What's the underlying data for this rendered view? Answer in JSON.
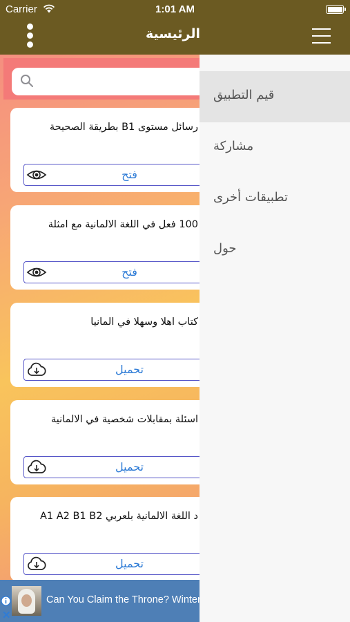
{
  "status_bar": {
    "carrier": "Carrier",
    "time": "1:01 AM"
  },
  "nav": {
    "title": "الرئيسية"
  },
  "search": {
    "placeholder": ""
  },
  "cards": [
    {
      "title": "رسائل مستوى B1 بطريقة الصحيحة",
      "action": "فتح",
      "icon": "eye-icon"
    },
    {
      "title": "100 فعل في اللغة الالمانية مع امثلة",
      "action": "فتح",
      "icon": "eye-icon"
    },
    {
      "title": "كتاب اهلا وسهلا في المانيا",
      "action": "تحميل",
      "icon": "cloud-download-icon"
    },
    {
      "title": "اسئلة بمقابلات شخصية في الالمانية",
      "action": "تحميل",
      "icon": "cloud-download-icon"
    },
    {
      "title": "د اللغة الالمانية بلعربي A1 A2 B1 B2",
      "action": "تحميل",
      "icon": "cloud-download-icon"
    }
  ],
  "ad": {
    "text": "Can You Claim the Throne? Winter is Coming"
  },
  "drawer": {
    "items": [
      {
        "label": "قيم التطبيق"
      },
      {
        "label": "مشاركة"
      },
      {
        "label": "تطبيقات أخرى"
      },
      {
        "label": "حول"
      }
    ]
  },
  "colors": {
    "nav_bar": "#6b5a22",
    "action_border": "#5656c8",
    "action_text": "#2d7bd6",
    "drawer_bg": "#f7f7f7",
    "drawer_active": "#e4e4e4",
    "ad_bg": "#4e7fb6"
  }
}
